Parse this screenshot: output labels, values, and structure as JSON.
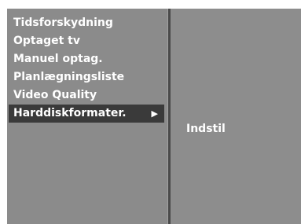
{
  "menu": {
    "items": [
      {
        "label": "Tidsforskydning"
      },
      {
        "label": "Optaget tv"
      },
      {
        "label": "Manuel optag."
      },
      {
        "label": "Planlægningsliste"
      },
      {
        "label": "Video Quality"
      },
      {
        "label": "Harddiskformater.",
        "selected": true
      }
    ],
    "arrow_glyph": "▶"
  },
  "submenu": {
    "items": [
      {
        "label": "Indstil"
      }
    ]
  },
  "colors": {
    "panel": "#8b8b8b",
    "selected": "#3a3a3a",
    "divider": "#4a4a4a",
    "text": "#ffffff"
  }
}
